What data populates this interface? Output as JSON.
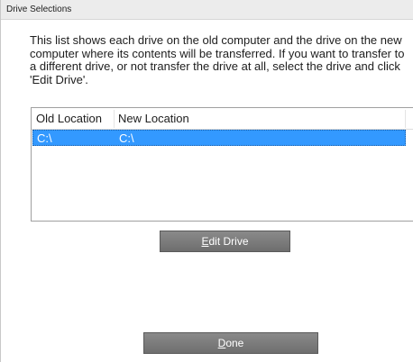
{
  "window": {
    "title": "Drive Selections"
  },
  "description": "This list shows each drive on the old computer and the drive on the new computer where its contents will be transferred. If you want to transfer to a different drive, or not transfer the drive at all, select the drive and click 'Edit Drive'.",
  "drive_list": {
    "columns": [
      "Old Location",
      "New Location"
    ],
    "rows": [
      {
        "old": "C:\\",
        "new": "C:\\",
        "selected": true
      }
    ]
  },
  "buttons": {
    "edit_drive": {
      "mnemonic": "E",
      "rest": "dit Drive"
    },
    "done": {
      "mnemonic": "D",
      "rest": "one"
    }
  },
  "colors": {
    "selection": "#3399ff",
    "button": "#7c7c7c"
  }
}
